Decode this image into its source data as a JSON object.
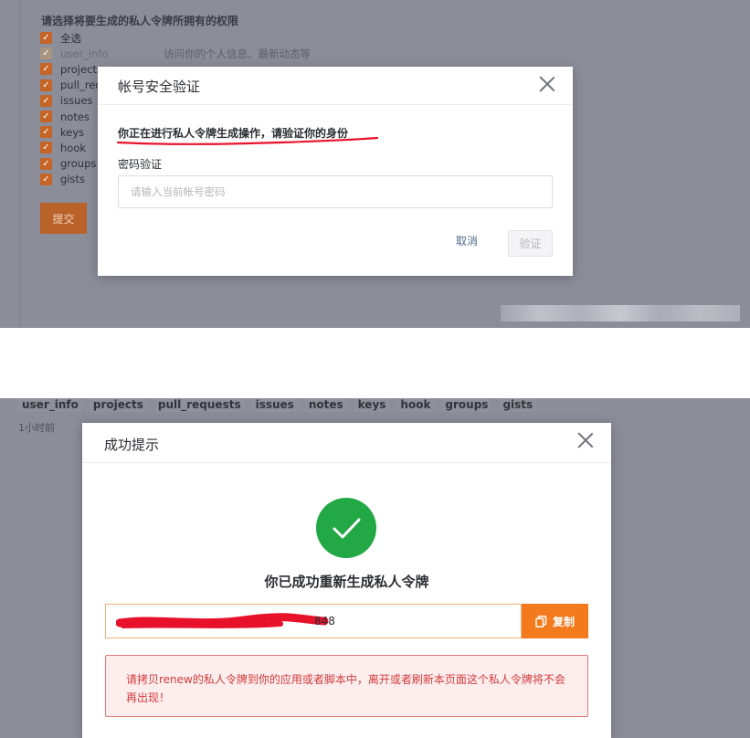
{
  "top": {
    "perm_title": "请选择将要生成的私人令牌所拥有的权限",
    "permissions": [
      {
        "name": "全选",
        "desc": "",
        "checked": true,
        "disabled": false
      },
      {
        "name": "user_info",
        "desc": "访问你的个人信息、最新动态等",
        "checked": true,
        "disabled": true
      },
      {
        "name": "projects",
        "desc": "",
        "checked": true,
        "disabled": false
      },
      {
        "name": "pull_requests",
        "desc": "",
        "checked": true,
        "disabled": false
      },
      {
        "name": "issues",
        "desc": "",
        "checked": true,
        "disabled": false
      },
      {
        "name": "notes",
        "desc": "",
        "checked": true,
        "disabled": false
      },
      {
        "name": "keys",
        "desc": "",
        "checked": true,
        "disabled": false
      },
      {
        "name": "hook",
        "desc": "",
        "checked": true,
        "disabled": false
      },
      {
        "name": "groups",
        "desc": "",
        "checked": true,
        "disabled": false
      },
      {
        "name": "gists",
        "desc": "",
        "checked": true,
        "disabled": false
      }
    ],
    "submit_label": "提交",
    "verify_modal": {
      "title": "帐号安全验证",
      "message": "你正在进行私人令牌生成操作，请验证你的身份",
      "password_label": "密码验证",
      "password_placeholder": "请输入当前帐号密码",
      "password_value": "",
      "cancel_label": "取消",
      "verify_label": "验证"
    }
  },
  "bottom": {
    "tags": [
      "user_info",
      "projects",
      "pull_requests",
      "issues",
      "notes",
      "keys",
      "hook",
      "groups",
      "gists"
    ],
    "time_text": "1小时前",
    "success_modal": {
      "title": "成功提示",
      "heading": "你已成功重新生成私人令牌",
      "token_visible_tail": "848",
      "copy_label": "复制",
      "warning": "请拷贝renew的私人令牌到你的应用或者脚本中，离开或者刷新本页面这个私人令牌将不会再出现！"
    }
  },
  "colors": {
    "overlay_bg": "#8b8d99",
    "checkbox": "#c56426",
    "copy_button": "#f37b1d",
    "success_green": "#23a846",
    "warning_text": "#d23b3b",
    "annotation_red": "#e8112a"
  },
  "icons": [
    "check-icon",
    "close-icon",
    "checkmark-circle-icon",
    "copy-icon"
  ]
}
